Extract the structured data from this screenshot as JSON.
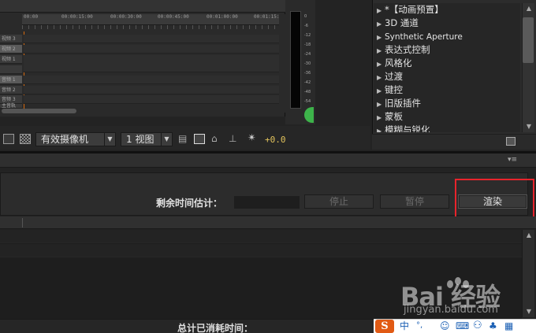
{
  "timeline": {
    "ruler_labels": [
      "00:00",
      "00:00:15:00",
      "00:00:30:00",
      "00:00:45:00",
      "00:01:00:00",
      "00:01:15:00"
    ],
    "tracks": [
      {
        "label": "视频 3",
        "active": false
      },
      {
        "label": "视频 2",
        "active": true
      },
      {
        "label": "视频 1",
        "active": false
      },
      {
        "label": "",
        "active": false
      },
      {
        "label": "",
        "active": false
      },
      {
        "label": "音频 1",
        "active": true
      },
      {
        "label": "音频 2",
        "active": false
      },
      {
        "label": "音频 3",
        "active": false
      },
      {
        "label": "主音轨",
        "active": false
      }
    ]
  },
  "audio_meter": {
    "db_labels": [
      "0",
      "-6",
      "-12",
      "-18",
      "-24",
      "-30",
      "-36",
      "-42",
      "-48",
      "-54"
    ]
  },
  "effects": {
    "items": [
      {
        "label": "*【动画预置】"
      },
      {
        "label": "3D 通道"
      },
      {
        "label": "Synthetic Aperture"
      },
      {
        "label": "表达式控制"
      },
      {
        "label": "风格化"
      },
      {
        "label": "过渡"
      },
      {
        "label": "键控"
      },
      {
        "label": "旧版插件"
      },
      {
        "label": "蒙板"
      },
      {
        "label": "模糊与锐化"
      }
    ]
  },
  "toolbar": {
    "camera_select": "有效摄像机",
    "view_select": "1 视图",
    "offset_value": "+0.0"
  },
  "render_queue": {
    "remaining_label": "剩余时间估计：",
    "stop_label": "停止",
    "pause_label": "暂停",
    "render_label": "渲染",
    "elapsed_label": "总计已消耗时间："
  },
  "watermark": {
    "brand": "Bai  经验",
    "url": "jingyan.baidu.com"
  },
  "ime": {
    "logo": "S",
    "mode": "中",
    "punct": "°,",
    "icons": [
      "mic-icon",
      "keyboard-icon",
      "user-icon",
      "shirt-icon",
      "grid-icon"
    ]
  },
  "colors": {
    "highlight": "#e8242c",
    "offset": "#e2c35c",
    "playhead": "#d76a0e",
    "ime_logo": "#e15a14"
  }
}
